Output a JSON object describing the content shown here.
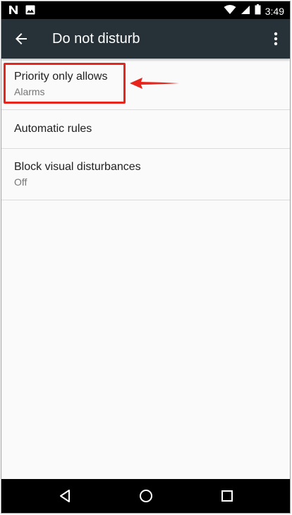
{
  "status_bar": {
    "time": "3:49",
    "left_icons": [
      "n-notification-icon",
      "image-notification-icon"
    ],
    "right_icons": [
      "wifi-icon",
      "cellular-signal-icon",
      "battery-icon"
    ]
  },
  "app_bar": {
    "title": "Do not disturb",
    "back_icon": "arrow-back-icon",
    "overflow_icon": "more-vert-icon",
    "background": "#263238"
  },
  "preferences": [
    {
      "title": "Priority only allows",
      "summary": "Alarms"
    },
    {
      "title": "Automatic rules",
      "summary": ""
    },
    {
      "title": "Block visual disturbances",
      "summary": "Off"
    }
  ],
  "annotation": {
    "highlight_color": "#e8251c",
    "target": "Priority only allows"
  },
  "nav_bar": {
    "buttons": [
      "back-triangle-icon",
      "home-circle-icon",
      "recents-square-icon"
    ]
  }
}
